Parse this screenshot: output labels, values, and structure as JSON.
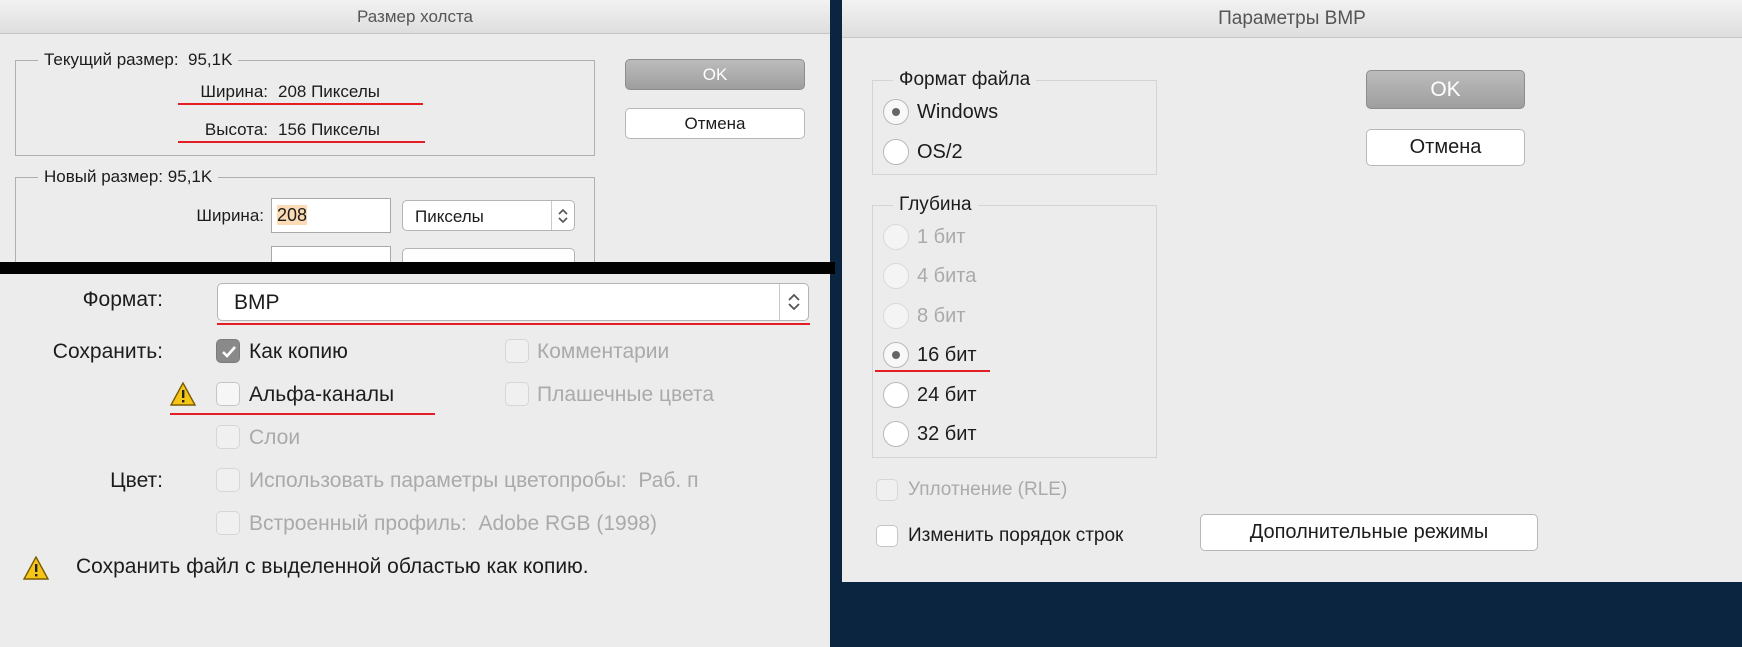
{
  "canvas_dialog": {
    "title": "Размер холста",
    "current_legend": "Текущий размер:",
    "current_size": "95,1K",
    "width_label": "Ширина:",
    "width_value": "208 Пикселы",
    "height_label": "Высота:",
    "height_value": "156 Пикселы",
    "new_legend": "Новый размер:",
    "new_size": "95,1K",
    "new_width_label": "Ширина:",
    "new_width_value": "208",
    "unit": "Пикселы",
    "ok": "OK",
    "cancel": "Отмена"
  },
  "save_panel": {
    "format_label": "Формат:",
    "format_value": "BMP",
    "save_label": "Сохранить:",
    "as_copy": "Как копию",
    "alpha": "Альфа-каналы",
    "layers": "Слои",
    "comments": "Комментарии",
    "spot": "Плашечные цвета",
    "color_label": "Цвет:",
    "use_proof": "Использовать параметры цветопробы:  Раб. п",
    "embed_profile": "Встроенный профиль:  Adobe RGB (1998)",
    "warning": "Сохранить файл с выделенной областью как копию."
  },
  "bmp_dialog": {
    "title": "Параметры BMP",
    "file_format_legend": "Формат файла",
    "windows": "Windows",
    "os2": "OS/2",
    "depth_legend": "Глубина",
    "d1": "1 бит",
    "d4": "4 бита",
    "d8": "8 бит",
    "d16": "16 бит",
    "d24": "24 бит",
    "d32": "32 бит",
    "rle": "Уплотнение (RLE)",
    "flip": "Изменить порядок строк",
    "ok": "OK",
    "cancel": "Отмена",
    "advanced": "Дополнительные режимы"
  },
  "colors": {
    "annotation_red": "#e31e25",
    "warning_yellow": "#f5c518",
    "selection_highlight": "#fddcb5"
  },
  "icons": [
    "warning-icon",
    "stepper-arrows-icon",
    "checkmark-icon"
  ]
}
